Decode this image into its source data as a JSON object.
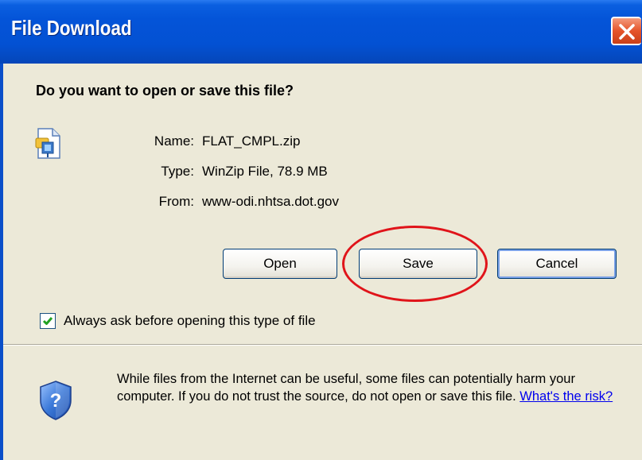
{
  "window": {
    "title": "File Download",
    "close_icon": "close-icon"
  },
  "dialog": {
    "question": "Do you want to open or save this file?",
    "file_icon": "zip-file-icon",
    "name_label": "Name:",
    "name_value": "FLAT_CMPL.zip",
    "type_label": "Type:",
    "type_value": "WinZip File, 78.9 MB",
    "from_label": "From:",
    "from_value": "www-odi.nhtsa.dot.gov"
  },
  "buttons": {
    "open_label": "Open",
    "save_label": "Save",
    "cancel_label": "Cancel"
  },
  "checkbox": {
    "label": "Always ask before opening this type of file",
    "checked": true
  },
  "warning": {
    "icon": "shield-question-icon",
    "text": "While files from the Internet can be useful, some files can potentially harm your computer. If you do not trust the source, do not open or save this file.",
    "link_text": "What's the risk?"
  },
  "annotation": {
    "highlight": "save-button",
    "color": "#e0141a"
  },
  "colors": {
    "titlebar": "#0454d8",
    "body": "#ece9d8",
    "close_button": "#e5542a"
  }
}
